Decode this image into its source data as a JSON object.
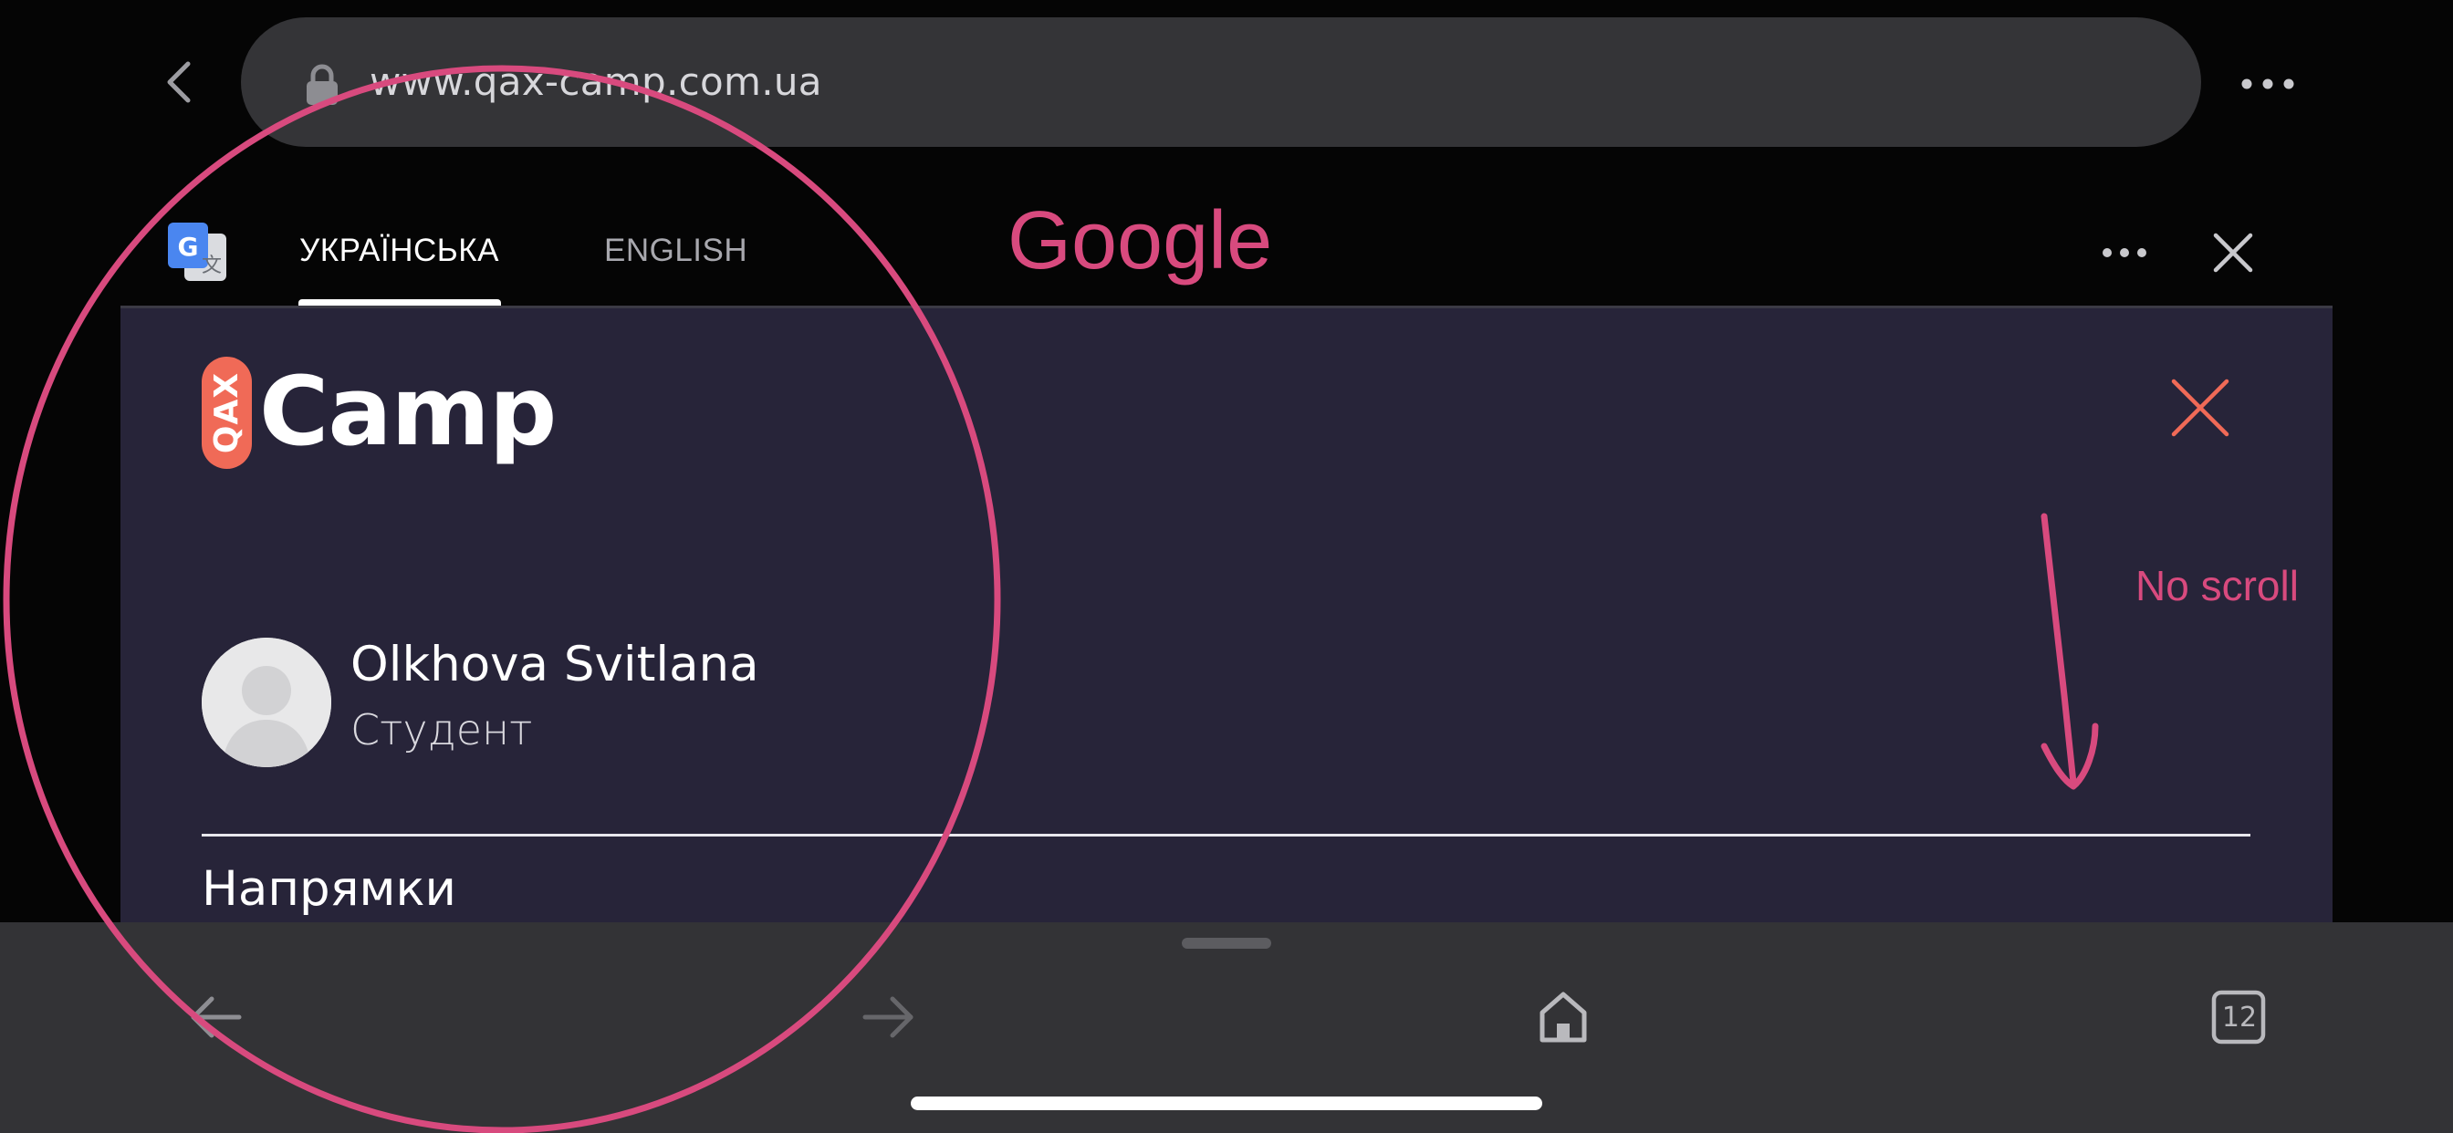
{
  "browser": {
    "url": "www.qax-camp.com.ua",
    "tab_count": "12"
  },
  "translate_bar": {
    "tabs": [
      {
        "label": "УКРАЇНСЬКА",
        "active": true
      },
      {
        "label": "ENGLISH",
        "active": false
      }
    ]
  },
  "annotations": {
    "google_label": "Google",
    "no_scroll_label": "No scroll",
    "color": "#d84a7e"
  },
  "page": {
    "brand": {
      "badge_text": "QAX",
      "name": "Camp",
      "badge_color": "#f06a57"
    },
    "user": {
      "name": "Olkhova Svitlana",
      "role": "Студент"
    },
    "section_heading": "Напрямки",
    "close_color": "#f06a57",
    "background": "#272439"
  },
  "icons": {
    "back": "chevron-left-icon",
    "lock": "lock-icon",
    "more": "more-horizontal-icon",
    "translate": "google-translate-icon",
    "close": "close-icon",
    "avatar": "user-avatar-icon",
    "toolbar": [
      "arrow-left-icon",
      "arrow-right-icon",
      "home-icon",
      "tabs-icon"
    ]
  }
}
